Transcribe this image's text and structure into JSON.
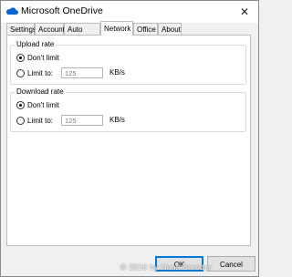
{
  "window": {
    "title": "Microsoft OneDrive",
    "close_glyph": "✕"
  },
  "tabs": [
    {
      "label": "Settings"
    },
    {
      "label": "Account"
    },
    {
      "label": "Auto Save"
    },
    {
      "label": "Network",
      "active": true
    },
    {
      "label": "Office"
    },
    {
      "label": "About"
    }
  ],
  "upload": {
    "title": "Upload rate",
    "dont_limit": "Don't limit",
    "limit_to": "Limit to:",
    "value": "125",
    "unit": "KB/s",
    "selected": "dont_limit"
  },
  "download": {
    "title": "Download rate",
    "dont_limit": "Don't limit",
    "limit_to": "Limit to:",
    "value": "125",
    "unit": "KB/s",
    "selected": "dont_limit"
  },
  "buttons": {
    "ok": "OK",
    "cancel": "Cancel"
  },
  "watermark": "© 2016 by Hans Brender",
  "colors": {
    "onedrive_blue": "#0a64d0",
    "accent": "#0078d7"
  }
}
